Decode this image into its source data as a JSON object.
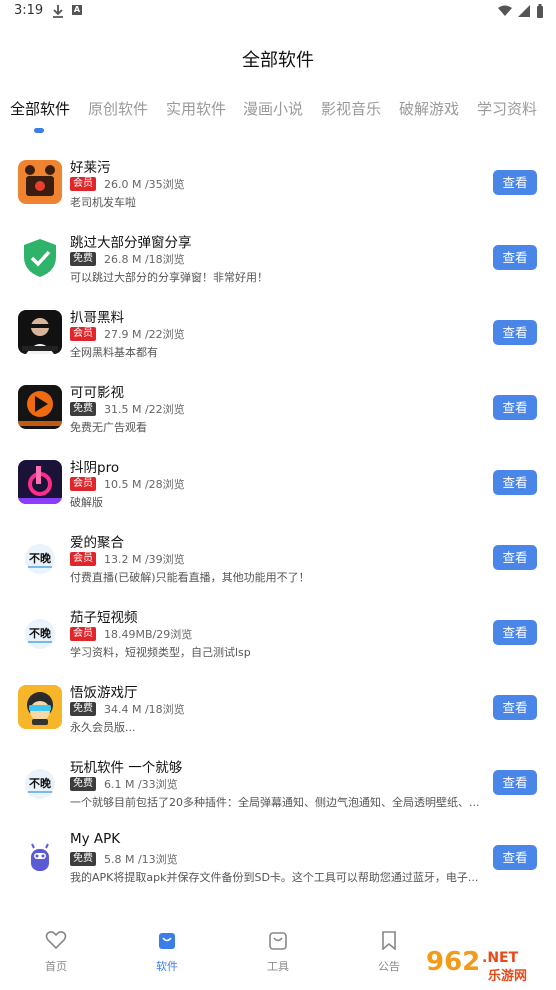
{
  "status": {
    "time": "3:19"
  },
  "page_title": "全部软件",
  "tabs": [
    "全部软件",
    "原创软件",
    "实用软件",
    "漫画小说",
    "影视音乐",
    "破解游戏",
    "学习资料"
  ],
  "view_label": "查看",
  "apps": [
    {
      "name": "好莱污",
      "badge": "会员",
      "badge_type": "vip",
      "meta": "26.0 M /35浏览",
      "desc": "老司机发车啦",
      "icon": "film-clapper-icon",
      "icon_color": "#f0832f"
    },
    {
      "name": "跳过大部分弹窗分享",
      "badge": "免费",
      "badge_type": "free",
      "meta": "26.8 M /18浏览",
      "desc": "可以跳过大部分的分享弹窗！非常好用！",
      "icon": "shield-check-icon",
      "icon_color": "#2fb36a"
    },
    {
      "name": "扒哥黑料",
      "badge": "会员",
      "badge_type": "vip",
      "meta": "27.9 M /22浏览",
      "desc": "全网黑料基本都有",
      "icon": "avatar-dark-icon",
      "icon_color": "#111111"
    },
    {
      "name": "可可影视",
      "badge": "免费",
      "badge_type": "free",
      "meta": "31.5 M /22浏览",
      "desc": "免费无广告观看",
      "icon": "keke-play-icon",
      "icon_color": "#f06a12"
    },
    {
      "name": "抖阴pro",
      "badge": "会员",
      "badge_type": "vip",
      "meta": "10.5 M /28浏览",
      "desc": "破解版",
      "icon": "douyin-pro-icon",
      "icon_color": "#1a1238"
    },
    {
      "name": "爱的聚合",
      "badge": "会员",
      "badge_type": "vip",
      "meta": "13.2 M /39浏览",
      "desc": "付费直播(已破解)只能看直播，其他功能用不了！",
      "icon": "buwan-logo-icon",
      "icon_color": "#ffffff"
    },
    {
      "name": "茄子短视频",
      "badge": "会员",
      "badge_type": "vip",
      "meta": "18.49MB/29浏览",
      "desc": "学习资料，短视频类型，自己测试lsp",
      "icon": "buwan-logo-icon",
      "icon_color": "#ffffff"
    },
    {
      "name": "悟饭游戏厅",
      "badge": "免费",
      "badge_type": "free",
      "meta": "34.4 M /18浏览",
      "desc": "永久会员版...",
      "icon": "wufan-game-icon",
      "icon_color": "#f7b52a"
    },
    {
      "name": "玩机软件 一个就够",
      "badge": "免费",
      "badge_type": "free",
      "meta": "6.1 M /33浏览",
      "desc": "一个就够目前包括了20多种插件：全局弹幕通知、侧边气泡通知、全局透明壁纸、...",
      "icon": "buwan-logo-icon",
      "icon_color": "#ffffff"
    },
    {
      "name": "My APK",
      "badge": "免费",
      "badge_type": "free",
      "meta": "5.8 M /13浏览",
      "desc": "我的APK将提取apk并保存文件备份到SD卡。这个工具可以帮助您通过蓝牙，电子...",
      "icon": "android-robot-icon",
      "icon_color": "#5b5bd6"
    }
  ],
  "bottom_nav": [
    {
      "label": "首页",
      "icon": "heart-icon"
    },
    {
      "label": "软件",
      "icon": "bag-icon"
    },
    {
      "label": "工具",
      "icon": "bag-outline-icon"
    },
    {
      "label": "公告",
      "icon": "bookmark-icon"
    }
  ],
  "watermark": {
    "brand": "962",
    "suffix": ".NET",
    "sub": "乐游网"
  }
}
